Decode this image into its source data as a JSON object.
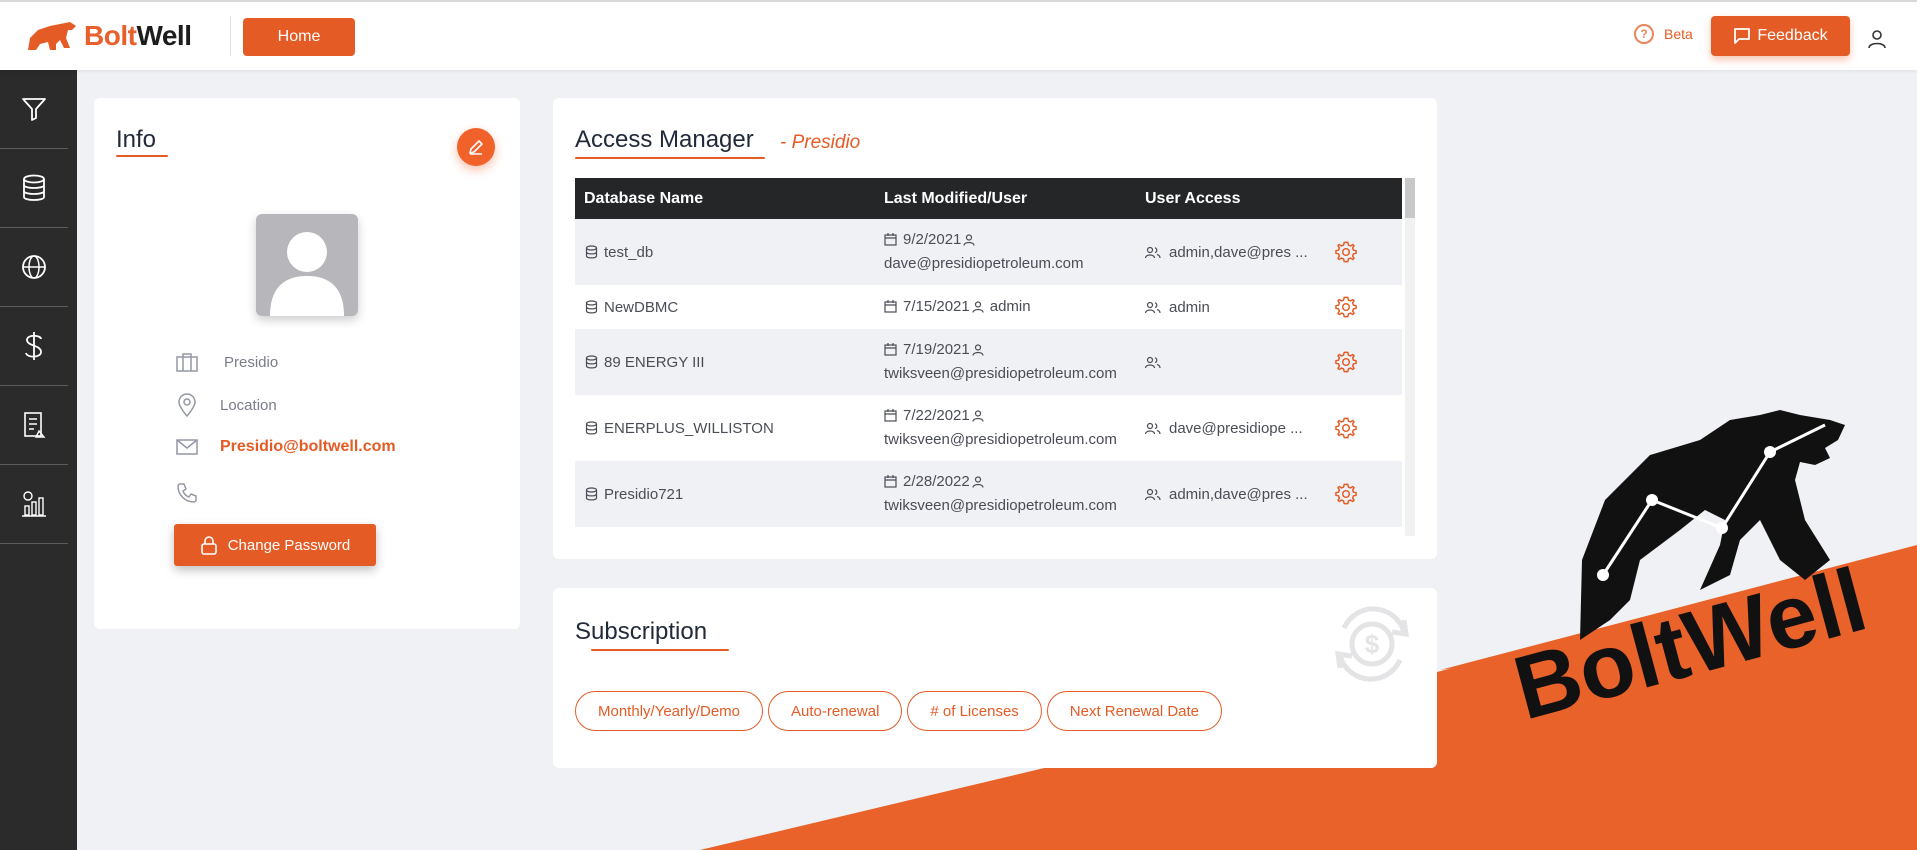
{
  "brand": {
    "name_part1": "Bolt",
    "name_part2": "Well",
    "accent_color": "#e55b25",
    "banner_text": "BoltWell"
  },
  "header": {
    "home_label": "Home",
    "beta_label": "Beta",
    "feedback_label": "Feedback",
    "icons": [
      "help-icon",
      "chat-icon",
      "user-icon"
    ]
  },
  "sidebar": {
    "items": [
      {
        "icon": "filter-icon"
      },
      {
        "icon": "database-icon"
      },
      {
        "icon": "globe-icon"
      },
      {
        "icon": "dollar-icon"
      },
      {
        "icon": "report-icon"
      },
      {
        "icon": "analytics-icon"
      }
    ]
  },
  "info": {
    "title": "Info",
    "company": "Presidio",
    "location": "Location",
    "email": "Presidio@boltwell.com",
    "phone": "",
    "change_password_label": "Change Password"
  },
  "access_manager": {
    "title": "Access Manager",
    "subtitle": "- Presidio",
    "columns": {
      "name": "Database Name",
      "modified": "Last Modified/User",
      "access": "User Access"
    },
    "rows": [
      {
        "name": "test_db",
        "date": "9/2/2021",
        "user": "dave@presidiopetroleum.com",
        "access": "admin,dave@pres ..."
      },
      {
        "name": "NewDBMC",
        "date": "7/15/2021",
        "user": "admin",
        "access": "admin"
      },
      {
        "name": "89 ENERGY III",
        "date": "7/19/2021",
        "user": "twiksveen@presidiopetroleum.com",
        "access": ""
      },
      {
        "name": "ENERPLUS_WILLISTON",
        "date": "7/22/2021",
        "user": "twiksveen@presidiopetroleum.com",
        "access": "dave@presidiope ..."
      },
      {
        "name": "Presidio721",
        "date": "2/28/2022",
        "user": "twiksveen@presidiopetroleum.com",
        "access": "admin,dave@pres ..."
      }
    ]
  },
  "subscription": {
    "title": "Subscription",
    "pills": [
      "Monthly/Yearly/Demo",
      "Auto-renewal",
      "# of Licenses",
      "Next Renewal Date"
    ]
  }
}
